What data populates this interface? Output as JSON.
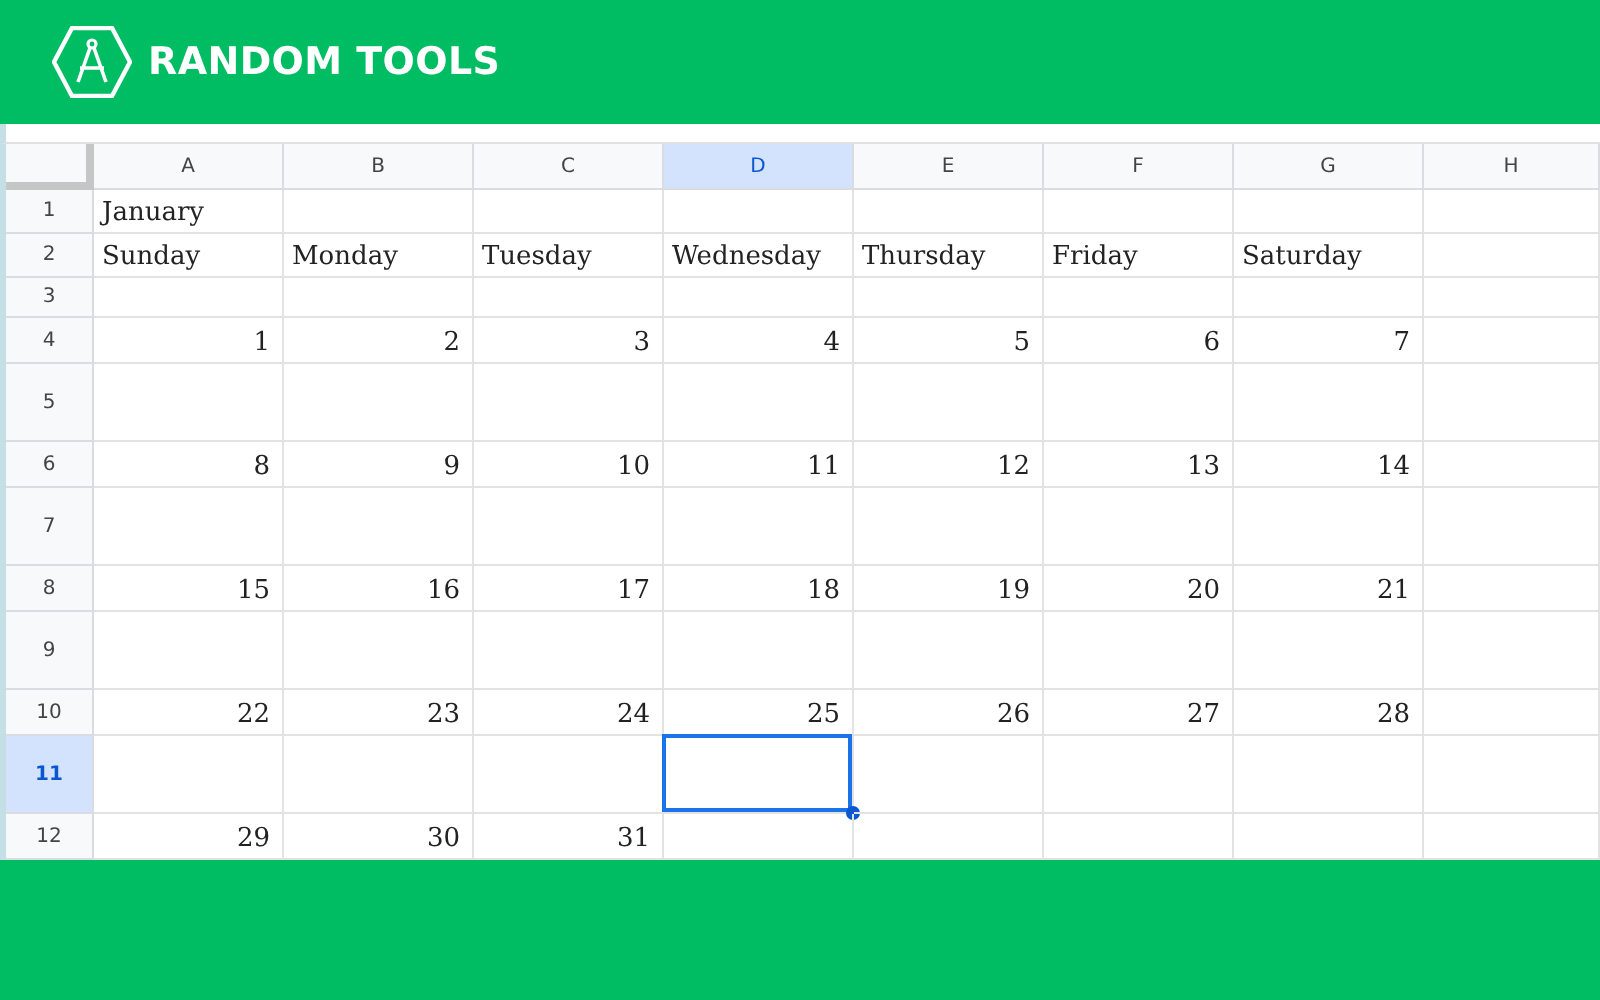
{
  "brand": {
    "name": "RANDOM TOOLS"
  },
  "columns": [
    {
      "label": "A",
      "selected": false
    },
    {
      "label": "B",
      "selected": false
    },
    {
      "label": "C",
      "selected": false
    },
    {
      "label": "D",
      "selected": true
    },
    {
      "label": "E",
      "selected": false
    },
    {
      "label": "F",
      "selected": false
    },
    {
      "label": "G",
      "selected": false
    },
    {
      "label": "H",
      "selected": false
    }
  ],
  "rows": [
    {
      "label": "1",
      "kind": "label",
      "selected": false,
      "cells": [
        "January"
      ]
    },
    {
      "label": "2",
      "kind": "label",
      "selected": false,
      "cells": [
        "Sunday",
        "Monday",
        "Tuesday",
        "Wednesday",
        "Thursday",
        "Friday",
        "Saturday"
      ]
    },
    {
      "label": "3",
      "kind": "blank",
      "selected": false,
      "cells": []
    },
    {
      "label": "4",
      "kind": "dates",
      "selected": false,
      "cells": [
        "1",
        "2",
        "3",
        "4",
        "5",
        "6",
        "7"
      ]
    },
    {
      "label": "5",
      "kind": "notes",
      "selected": false,
      "cells": []
    },
    {
      "label": "6",
      "kind": "dates",
      "selected": false,
      "cells": [
        "8",
        "9",
        "10",
        "11",
        "12",
        "13",
        "14"
      ]
    },
    {
      "label": "7",
      "kind": "notes",
      "selected": false,
      "cells": []
    },
    {
      "label": "8",
      "kind": "dates",
      "selected": false,
      "cells": [
        "15",
        "16",
        "17",
        "18",
        "19",
        "20",
        "21"
      ]
    },
    {
      "label": "9",
      "kind": "notes",
      "selected": false,
      "cells": []
    },
    {
      "label": "10",
      "kind": "dates",
      "selected": false,
      "cells": [
        "22",
        "23",
        "24",
        "25",
        "26",
        "27",
        "28"
      ]
    },
    {
      "label": "11",
      "kind": "notes",
      "selected": true,
      "cells": []
    },
    {
      "label": "12",
      "kind": "dates",
      "selected": false,
      "cells": [
        "29",
        "30",
        "31"
      ]
    }
  ]
}
